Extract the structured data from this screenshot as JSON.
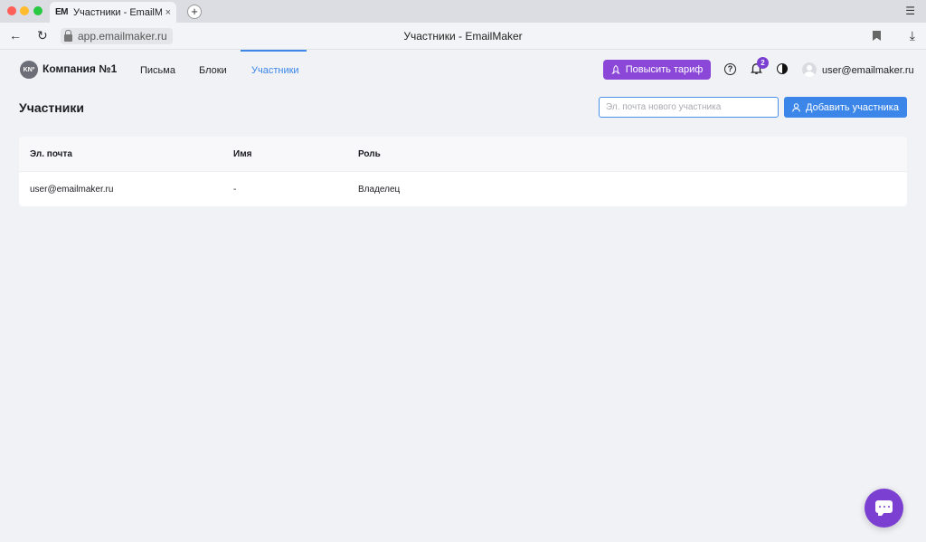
{
  "browser": {
    "tab_favicon": "EM",
    "tab_title": "Участники - EmailMaker",
    "tab_close": "×",
    "new_tab": "+",
    "url": "app.emailmaker.ru",
    "window_title": "Участники - EmailMaker"
  },
  "header": {
    "company_logo": "KNº",
    "company_name": "Компания №1",
    "nav": {
      "letters": "Письма",
      "blocks": "Блоки",
      "members": "Участники"
    },
    "upgrade_label": "Повысить тариф",
    "notifications_count": "2",
    "help_glyph": "?",
    "user_email": "user@emailmaker.ru"
  },
  "page": {
    "title": "Участники",
    "new_member_placeholder": "Эл. почта нового участника",
    "new_member_value": "",
    "add_label": "Добавить участника"
  },
  "table": {
    "columns": [
      "Эл. почта",
      "Имя",
      "Роль"
    ],
    "rows": [
      [
        "user@emailmaker.ru",
        "-",
        "Владелец"
      ]
    ]
  },
  "colors": {
    "accent_blue": "#3b86e8",
    "accent_purple": "#8b48d8"
  }
}
